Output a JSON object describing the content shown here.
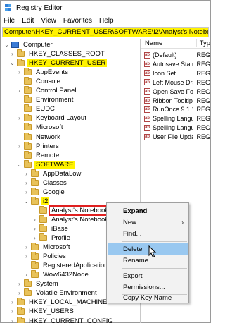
{
  "window": {
    "title": "Registry Editor"
  },
  "menubar": [
    "File",
    "Edit",
    "View",
    "Favorites",
    "Help"
  ],
  "address": "Computer\\HKEY_CURRENT_USER\\SOFTWARE\\i2\\Analyst's Notebook 7",
  "tree": {
    "items": [
      {
        "label": "Computer",
        "arrow": "⌄",
        "icon": "computer"
      },
      {
        "label": "HKEY_CLASSES_ROOT",
        "arrow": "›",
        "icon": "folder"
      },
      {
        "label": "HKEY_CURRENT_USER",
        "arrow": "⌄",
        "icon": "folder",
        "highlight": "yellow"
      },
      {
        "label": "AppEvents",
        "arrow": "›",
        "icon": "folder"
      },
      {
        "label": "Console",
        "arrow": "",
        "icon": "folder"
      },
      {
        "label": "Control Panel",
        "arrow": "›",
        "icon": "folder"
      },
      {
        "label": "Environment",
        "arrow": "",
        "icon": "folder"
      },
      {
        "label": "EUDC",
        "arrow": "",
        "icon": "folder"
      },
      {
        "label": "Keyboard Layout",
        "arrow": "›",
        "icon": "folder"
      },
      {
        "label": "Microsoft",
        "arrow": "",
        "icon": "folder"
      },
      {
        "label": "Network",
        "arrow": "",
        "icon": "folder"
      },
      {
        "label": "Printers",
        "arrow": "›",
        "icon": "folder"
      },
      {
        "label": "Remote",
        "arrow": "",
        "icon": "folder"
      },
      {
        "label": "SOFTWARE",
        "arrow": "⌄",
        "icon": "folder",
        "highlight": "yellow"
      },
      {
        "label": "AppDataLow",
        "arrow": "›",
        "icon": "folder"
      },
      {
        "label": "Classes",
        "arrow": "›",
        "icon": "folder"
      },
      {
        "label": "Google",
        "arrow": "›",
        "icon": "folder"
      },
      {
        "label": "i2",
        "arrow": "⌄",
        "icon": "folder",
        "highlight": "yellow"
      },
      {
        "label": "Analyst's Notebook 7",
        "arrow": "",
        "icon": "folder",
        "highlight": "red"
      },
      {
        "label": "Analyst's Notebook C",
        "arrow": "›",
        "icon": "folder"
      },
      {
        "label": "iBase",
        "arrow": "›",
        "icon": "folder"
      },
      {
        "label": "Profile",
        "arrow": "›",
        "icon": "folder"
      },
      {
        "label": "Microsoft",
        "arrow": "›",
        "icon": "folder"
      },
      {
        "label": "Policies",
        "arrow": "›",
        "icon": "folder"
      },
      {
        "label": "RegisteredApplications",
        "arrow": "",
        "icon": "folder"
      },
      {
        "label": "Wow6432Node",
        "arrow": "›",
        "icon": "folder"
      },
      {
        "label": "System",
        "arrow": "›",
        "icon": "folder"
      },
      {
        "label": "Volatile Environment",
        "arrow": "›",
        "icon": "folder"
      },
      {
        "label": "HKEY_LOCAL_MACHINE",
        "arrow": "›",
        "icon": "folder"
      },
      {
        "label": "HKEY_USERS",
        "arrow": "›",
        "icon": "folder"
      },
      {
        "label": "HKEY_CURRENT_CONFIG",
        "arrow": "›",
        "icon": "folder"
      }
    ]
  },
  "values_list": {
    "headers": {
      "name": "Name",
      "type": "Typ"
    },
    "rows": [
      {
        "name": "(Default)",
        "type": "REG"
      },
      {
        "name": "Autosave Status",
        "type": "REG"
      },
      {
        "name": "Icon Set",
        "type": "REG"
      },
      {
        "name": "Left Mouse Drag...",
        "type": "REG"
      },
      {
        "name": "Open Save Folder",
        "type": "REG"
      },
      {
        "name": "Ribbon Tooltips ...",
        "type": "REG"
      },
      {
        "name": "RunOnce 9.1.1",
        "type": "REG"
      },
      {
        "name": "Spelling Langua...",
        "type": "REG"
      },
      {
        "name": "Spelling Langua...",
        "type": "REG"
      },
      {
        "name": "User File Update...",
        "type": "REG"
      }
    ]
  },
  "context_menu": {
    "items": [
      {
        "label": "Expand",
        "bold": true
      },
      {
        "label": "New",
        "submenu": "›"
      },
      {
        "label": "Find..."
      },
      {
        "label": "Delete",
        "hover": true
      },
      {
        "label": "Rename"
      },
      {
        "label": "Export"
      },
      {
        "label": "Permissions..."
      },
      {
        "label": "Copy Key Name"
      }
    ]
  }
}
